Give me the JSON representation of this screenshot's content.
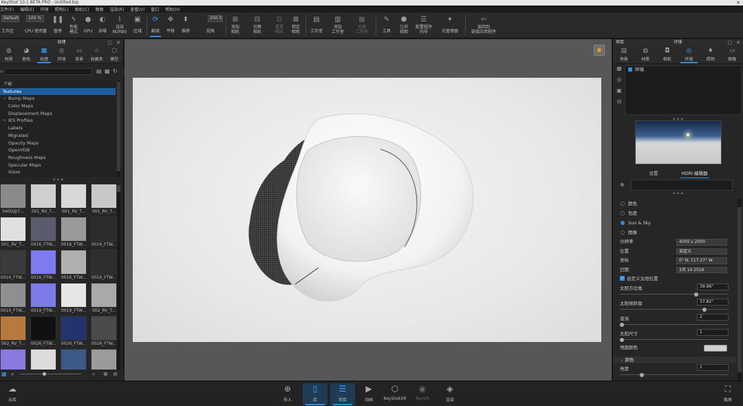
{
  "window": {
    "title": "KeyShot 10.1 BETA PRO - Untitled.bip",
    "close_glyph": "✕"
  },
  "menu": [
    "文件(F)",
    "编辑(E)",
    "环境",
    "照明(L)",
    "相机(C)",
    "图像",
    "渲染(R)",
    "查看(V)",
    "窗口",
    "帮助(H)"
  ],
  "toolbar": {
    "workspace_select": "Default",
    "zoom_select": "100 %",
    "workspace_label": "工作区",
    "cpu_label": "CPU 使用量",
    "pause_label": "暂停",
    "perf_mode_label": "性能\n模式",
    "gpu_label": "GPU",
    "denoise_label": "去噪",
    "render_nurbs_label": "渲染\nNURBS",
    "region_label": "区域",
    "tumble_label": "翻滚",
    "pan_label": "平移",
    "dolly_label": "推移",
    "fov_value": "200.0",
    "fov_label": "视角",
    "add_camera_label": "添加\n相机",
    "switch_camera_label": "切换\n相机",
    "reset_camera_label": "重置\n相机",
    "lock_camera_label": "锁定\n相机",
    "studio_label": "工作室",
    "add_studio_label": "添加\n工作室",
    "switch_studio_label": "切换\n工作室",
    "tools_label": "工具",
    "geometry_view_label": "几何\n视图",
    "config_wizard_label": "配置程序\n向导",
    "light_manager_label": "光管理器",
    "back_to_linked_label": "返回到\n链接应用程序"
  },
  "left_panel": {
    "title": "纹理",
    "tabs": [
      {
        "label": "材质",
        "icon": "sphere-icon"
      },
      {
        "label": "颜色",
        "icon": "palette-icon"
      },
      {
        "label": "纹理",
        "icon": "checker-icon"
      },
      {
        "label": "环境",
        "icon": "globe-icon"
      },
      {
        "label": "背景",
        "icon": "image-icon"
      },
      {
        "label": "收藏夹",
        "icon": "star-icon"
      },
      {
        "label": "模型",
        "icon": "cube-icon"
      }
    ],
    "tree": [
      {
        "label": "下载",
        "kind": "root"
      },
      {
        "label": "Textures",
        "kind": "sel"
      },
      {
        "label": "Bump Maps",
        "kind": "exp"
      },
      {
        "label": "Color Maps",
        "kind": "item"
      },
      {
        "label": "Displacement Maps",
        "kind": "item"
      },
      {
        "label": "IES Profiles",
        "kind": "exp"
      },
      {
        "label": "Labels",
        "kind": "item"
      },
      {
        "label": "Migrated",
        "kind": "item"
      },
      {
        "label": "Opacity Maps",
        "kind": "item"
      },
      {
        "label": "OpenVDB",
        "kind": "item"
      },
      {
        "label": "Roughness Maps",
        "kind": "item"
      },
      {
        "label": "Specular Maps",
        "kind": "item"
      },
      {
        "label": "Vizoo",
        "kind": "item"
      }
    ],
    "thumbnails": [
      {
        "caption": "540D@7...",
        "color": "#8a8a8a"
      },
      {
        "caption": "001_RV_T...",
        "color": "#cfcfcf"
      },
      {
        "caption": "001_RV_T...",
        "color": "#d8d8d8"
      },
      {
        "caption": "001_RV_T...",
        "color": "#c8c8c8"
      },
      {
        "caption": "001_RV_T...",
        "color": "#e0e0e0"
      },
      {
        "caption": "0016_FTW...",
        "color": "#5b5b6e"
      },
      {
        "caption": "0016_FTW...",
        "color": "#9a9a9a"
      },
      {
        "caption": "0016_FTW...",
        "color": "#2c2c2c"
      },
      {
        "caption": "0016_FTW...",
        "color": "#3a3a3a"
      },
      {
        "caption": "0016_FTW...",
        "color": "#7e7af0"
      },
      {
        "caption": "0016_FTW...",
        "color": "#b0b0b0"
      },
      {
        "caption": "0019_FTW...",
        "color": "#2e2e2e"
      },
      {
        "caption": "0019_FTW...",
        "color": "#8f8f8f"
      },
      {
        "caption": "0019_FTW...",
        "color": "#7b7bea"
      },
      {
        "caption": "0019_FTW...",
        "color": "#e6e6e6"
      },
      {
        "caption": "002_RV_T...",
        "color": "#a9a9a9"
      },
      {
        "caption": "002_RV_T...",
        "color": "#b77a3e"
      },
      {
        "caption": "0026_FTW...",
        "color": "#111111"
      },
      {
        "caption": "0026_FTW...",
        "color": "#23336e"
      },
      {
        "caption": "0026_FTW...",
        "color": "#4b4b4b"
      },
      {
        "caption": "",
        "color": "#8a7adf"
      },
      {
        "caption": "",
        "color": "#dcdcdc"
      },
      {
        "caption": "",
        "color": "#3d5a86"
      },
      {
        "caption": "",
        "color": "#9b9b9b"
      }
    ]
  },
  "right_panel": {
    "title_left": "项目",
    "title": "环境",
    "tabs": [
      {
        "label": "场景",
        "icon": "scene-icon"
      },
      {
        "label": "材质",
        "icon": "sphere-icon"
      },
      {
        "label": "相机",
        "icon": "camera-icon"
      },
      {
        "label": "环境",
        "icon": "globe-icon"
      },
      {
        "label": "照明",
        "icon": "bulb-icon"
      },
      {
        "label": "图像",
        "icon": "frame-icon"
      }
    ],
    "env_item": "环境",
    "subtabs": [
      "设置",
      "HDRI 编辑器"
    ],
    "radios": [
      "颜色",
      "色度",
      "Sun & Sky",
      "图像"
    ],
    "resolution_label": "分辨率",
    "resolution_value": "4000 x 2000",
    "location_label": "位置",
    "location_value": "自定义",
    "coords_label": "坐标",
    "coords_value": "0° N, 117.27° W",
    "date_label": "日期",
    "date_value": "3月 14 2016",
    "custom_sun_label": "自定义太阳位置",
    "azimuth_label": "太阳方位角",
    "azimuth_value": "39.96°",
    "azimuth": 0.7,
    "elevation_label": "太阳倾斜角",
    "elevation_value": "37.82°",
    "elevation": 0.78,
    "haze_label": "混浊",
    "haze_value": "2",
    "haze": 0.02,
    "sun_size_label": "太阳尺寸",
    "sun_size_value": "1",
    "sun_size": 0.02,
    "ground_color_label": "地面颜色",
    "ground_color": "#cfcfcf",
    "color_section_label": "颜色",
    "brightness_label": "亮度",
    "brightness_value": "1",
    "brightness": 0.2
  },
  "bottom_bar": {
    "cloud_label": "云库",
    "import_label": "导入",
    "library_label": "库",
    "project_label": "项目",
    "animation_label": "动画",
    "keyshotxr_label": "KeyShotXR",
    "keyvr_label": "KeyVR",
    "render_label": "渲染",
    "screenshot_label": "截屏"
  },
  "accent_color": "#2f8fe0"
}
